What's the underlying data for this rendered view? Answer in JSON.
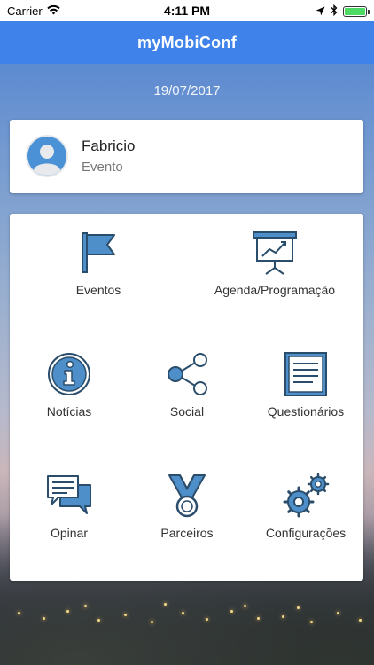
{
  "status_bar": {
    "carrier": "Carrier",
    "time": "4:11 PM"
  },
  "nav": {
    "title": "myMobiConf"
  },
  "date": "19/07/2017",
  "profile": {
    "name": "Fabricio",
    "subtitle": "Evento"
  },
  "menu": {
    "items": [
      {
        "label": "Eventos",
        "icon": "flag-icon"
      },
      {
        "label": "Agenda/Programação",
        "icon": "presentation-chart-icon"
      },
      {
        "label": "Notícias",
        "icon": "info-icon"
      },
      {
        "label": "Social",
        "icon": "share-icon"
      },
      {
        "label": "Questionários",
        "icon": "document-list-icon"
      },
      {
        "label": "Opinar",
        "icon": "chat-bubbles-icon"
      },
      {
        "label": "Parceiros",
        "icon": "medal-icon"
      },
      {
        "label": "Configurações",
        "icon": "gears-icon"
      }
    ]
  },
  "colors": {
    "nav_bar": "#3f82ea",
    "icon_stroke": "#2a4d6b",
    "icon_fill": "#4e8fc9",
    "battery": "#4cd964"
  }
}
